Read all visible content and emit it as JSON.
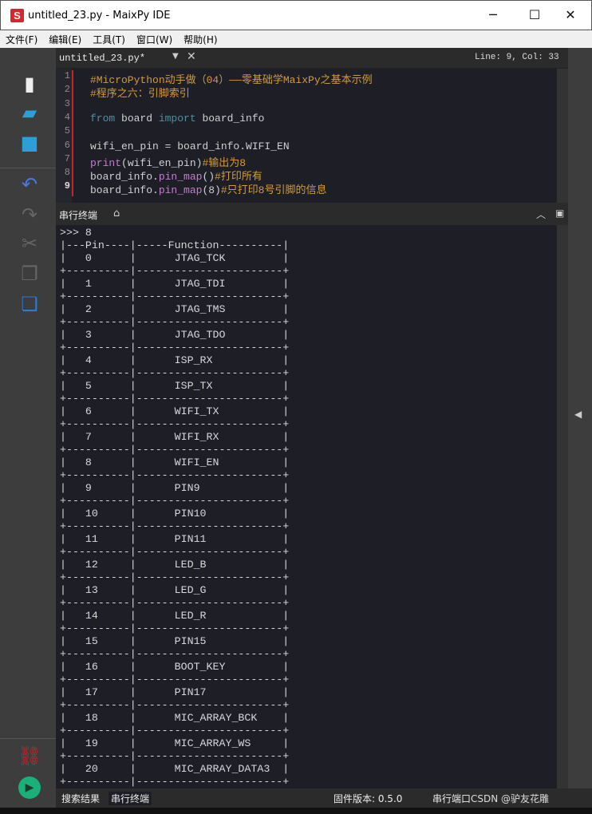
{
  "window": {
    "title": "untitled_23.py - MaixPy IDE",
    "logo": "S",
    "minimize": "─",
    "maximize": "☐",
    "close": "✕"
  },
  "menu": [
    "文件(F)",
    "编辑(E)",
    "工具(T)",
    "窗口(W)",
    "帮助(H)"
  ],
  "tab": {
    "filename": "untitled_23.py*",
    "cursor": "Line: 9, Col: 33"
  },
  "code": [
    [
      {
        "t": "#MicroPython动手做（04）——零基础学MaixPy之基本示例",
        "c": "cm"
      }
    ],
    [
      {
        "t": "#程序之六：引脚索引",
        "c": "cm"
      }
    ],
    [],
    [
      {
        "t": "from",
        "c": "kw"
      },
      {
        "t": " board "
      },
      {
        "t": "import",
        "c": "kw"
      },
      {
        "t": " board_info"
      }
    ],
    [],
    [
      {
        "t": "wifi_en_pin = board_info.WIFI_EN"
      }
    ],
    [
      {
        "t": "print",
        "c": "fn"
      },
      {
        "t": "(wifi_en_pin)"
      },
      {
        "t": "#输出为8",
        "c": "cm"
      }
    ],
    [
      {
        "t": "board_info."
      },
      {
        "t": "pin_map",
        "c": "fn"
      },
      {
        "t": "()"
      },
      {
        "t": "#打印所有",
        "c": "cm"
      }
    ],
    [
      {
        "t": "board_info."
      },
      {
        "t": "pin_map",
        "c": "fn"
      },
      {
        "t": "(8)"
      },
      {
        "t": "#只打印8号引脚的信息",
        "c": "cm"
      }
    ]
  ],
  "terminal": {
    "title": "串行终端",
    "lines": [
      ">>> 8",
      "|---Pin----|-----Function----------|",
      "|   0      |      JTAG_TCK         |",
      "+----------|-----------------------+",
      "|   1      |      JTAG_TDI         |",
      "+----------|-----------------------+",
      "|   2      |      JTAG_TMS         |",
      "+----------|-----------------------+",
      "|   3      |      JTAG_TDO         |",
      "+----------|-----------------------+",
      "|   4      |      ISP_RX           |",
      "+----------|-----------------------+",
      "|   5      |      ISP_TX           |",
      "+----------|-----------------------+",
      "|   6      |      WIFI_TX          |",
      "+----------|-----------------------+",
      "|   7      |      WIFI_RX          |",
      "+----------|-----------------------+",
      "|   8      |      WIFI_EN          |",
      "+----------|-----------------------+",
      "|   9      |      PIN9             |",
      "+----------|-----------------------+",
      "|   10     |      PIN10            |",
      "+----------|-----------------------+",
      "|   11     |      PIN11            |",
      "+----------|-----------------------+",
      "|   12     |      LED_B            |",
      "+----------|-----------------------+",
      "|   13     |      LED_G            |",
      "+----------|-----------------------+",
      "|   14     |      LED_R            |",
      "+----------|-----------------------+",
      "|   15     |      PIN15            |",
      "+----------|-----------------------+",
      "|   16     |      BOOT_KEY         |",
      "+----------|-----------------------+",
      "|   17     |      PIN17            |",
      "+----------|-----------------------+",
      "|   18     |      MIC_ARRAY_BCK    |",
      "+----------|-----------------------+",
      "|   19     |      MIC_ARRAY_WS     |",
      "+----------|-----------------------+",
      "|   20     |      MIC_ARRAY_DATA3  |",
      "+----------|-----------------------+"
    ]
  },
  "status": {
    "search_results": "搜索结果",
    "serial_terminal": "串行终端",
    "firmware": "固件版本: 0.5.0",
    "serial_port": "串行端口",
    "watermark": "CSDN @驴友花雕"
  },
  "colors": {
    "accent_red": "#c0272d",
    "comment": "#d49a38",
    "keyword": "#4e8fa0",
    "function": "#c57ccf"
  }
}
